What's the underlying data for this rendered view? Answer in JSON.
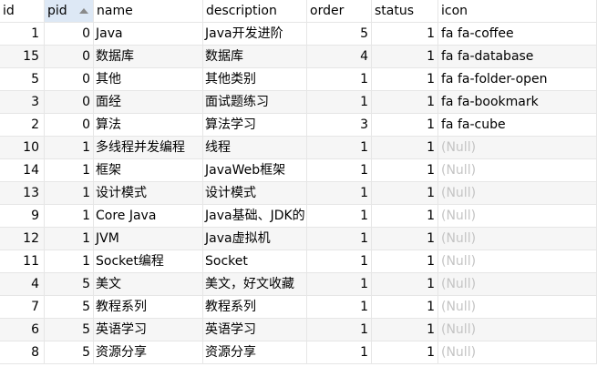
{
  "columns": {
    "id": "id",
    "pid": "pid",
    "name": "name",
    "description": "description",
    "order": "order",
    "status": "status",
    "icon": "icon"
  },
  "sort": {
    "column": "pid",
    "direction": "ascending",
    "indicator_icon": "sort-ascending-icon"
  },
  "null_color": "#c4c4c4",
  "rows": [
    {
      "id": "1",
      "pid": "0",
      "name": "Java",
      "description": "Java开发进阶",
      "order": "5",
      "status": "1",
      "icon": "fa fa-coffee"
    },
    {
      "id": "15",
      "pid": "0",
      "name": "数据库",
      "description": "数据库",
      "order": "4",
      "status": "1",
      "icon": "fa fa-database"
    },
    {
      "id": "5",
      "pid": "0",
      "name": "其他",
      "description": "其他类别",
      "order": "1",
      "status": "1",
      "icon": "fa fa-folder-open"
    },
    {
      "id": "3",
      "pid": "0",
      "name": "面经",
      "description": "面试题练习",
      "order": "1",
      "status": "1",
      "icon": "fa fa-bookmark"
    },
    {
      "id": "2",
      "pid": "0",
      "name": "算法",
      "description": "算法学习",
      "order": "3",
      "status": "1",
      "icon": "fa fa-cube"
    },
    {
      "id": "10",
      "pid": "1",
      "name": "多线程并发编程",
      "description": "线程",
      "order": "1",
      "status": "1",
      "icon": "(Null)"
    },
    {
      "id": "14",
      "pid": "1",
      "name": "框架",
      "description": "JavaWeb框架",
      "order": "1",
      "status": "1",
      "icon": "(Null)"
    },
    {
      "id": "13",
      "pid": "1",
      "name": "设计模式",
      "description": "设计模式",
      "order": "1",
      "status": "1",
      "icon": "(Null)"
    },
    {
      "id": "9",
      "pid": "1",
      "name": "Core Java",
      "description": "Java基础、JDK的",
      "order": "1",
      "status": "1",
      "icon": "(Null)"
    },
    {
      "id": "12",
      "pid": "1",
      "name": "JVM",
      "description": "Java虚拟机",
      "order": "1",
      "status": "1",
      "icon": "(Null)"
    },
    {
      "id": "11",
      "pid": "1",
      "name": "Socket编程",
      "description": "Socket",
      "order": "1",
      "status": "1",
      "icon": "(Null)"
    },
    {
      "id": "4",
      "pid": "5",
      "name": "美文",
      "description": "美文，好文收藏",
      "order": "1",
      "status": "1",
      "icon": "(Null)"
    },
    {
      "id": "7",
      "pid": "5",
      "name": "教程系列",
      "description": "教程系列",
      "order": "1",
      "status": "1",
      "icon": "(Null)"
    },
    {
      "id": "6",
      "pid": "5",
      "name": "英语学习",
      "description": "英语学习",
      "order": "1",
      "status": "1",
      "icon": "(Null)"
    },
    {
      "id": "8",
      "pid": "5",
      "name": "资源分享",
      "description": "资源分享",
      "order": "1",
      "status": "1",
      "icon": "(Null)"
    }
  ]
}
